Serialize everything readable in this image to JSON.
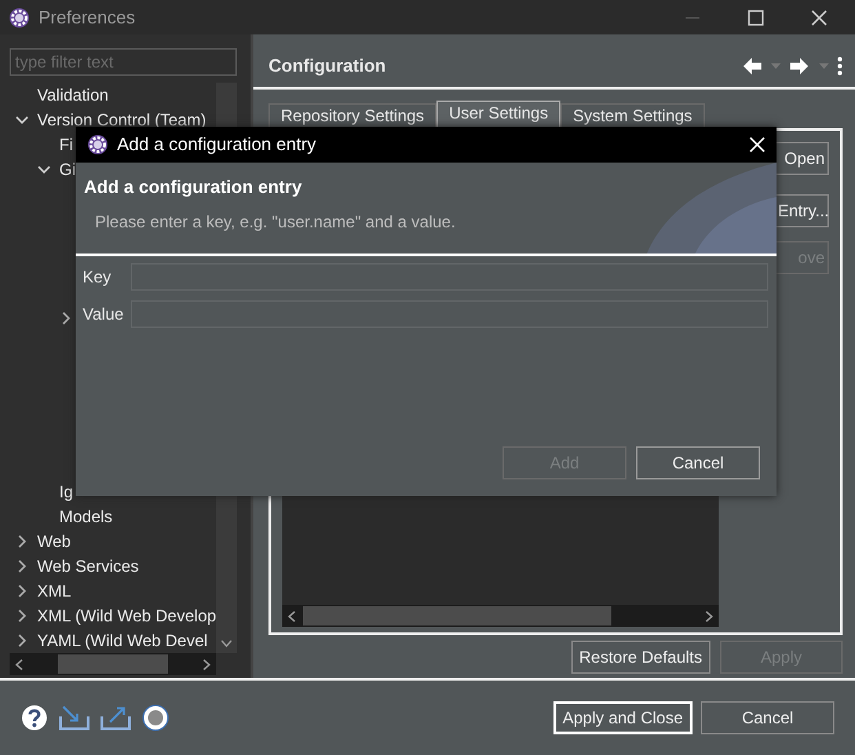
{
  "window": {
    "title": "Preferences"
  },
  "filter": {
    "placeholder": "type filter text"
  },
  "tree": [
    {
      "label": "Validation"
    },
    {
      "label": "Version Control (Team)",
      "expanded": true,
      "children": [
        {
          "label": "Fi"
        },
        {
          "label": "Gi",
          "expanded": true,
          "children": [
            {
              "expanded": false
            }
          ]
        },
        {
          "label": "Ig"
        },
        {
          "label": "Models"
        }
      ]
    },
    {
      "label": "Web",
      "expanded": false
    },
    {
      "label": "Web Services",
      "expanded": false
    },
    {
      "label": "XML",
      "expanded": false
    },
    {
      "label": "XML (Wild Web Develop",
      "expanded": false
    },
    {
      "label": "YAML (Wild Web Devel",
      "expanded": false
    }
  ],
  "page": {
    "title": "Configuration",
    "tabs": [
      {
        "label": "Repository Settings",
        "selected": false
      },
      {
        "label": "User Settings",
        "selected": true
      },
      {
        "label": "System Settings",
        "selected": false
      }
    ],
    "side_buttons": [
      {
        "label": "Open",
        "disabled": false
      },
      {
        "label": "Entry...",
        "disabled": false
      },
      {
        "label": "ove",
        "disabled": true
      }
    ],
    "buttons": [
      {
        "label": "Restore Defaults",
        "disabled": false
      },
      {
        "label": "Apply",
        "disabled": true
      }
    ]
  },
  "footer": {
    "buttons": [
      {
        "label": "Apply and Close",
        "default": true
      },
      {
        "label": "Cancel",
        "default": false
      }
    ]
  },
  "dialog": {
    "title": "Add a configuration entry",
    "heading": "Add a configuration entry",
    "message": "Please enter a key, e.g. \"user.name\" and a value.",
    "fields": [
      {
        "label": "Key"
      },
      {
        "label": "Value"
      }
    ],
    "buttons": [
      {
        "label": "Add",
        "disabled": true
      },
      {
        "label": "Cancel",
        "disabled": false
      }
    ]
  }
}
